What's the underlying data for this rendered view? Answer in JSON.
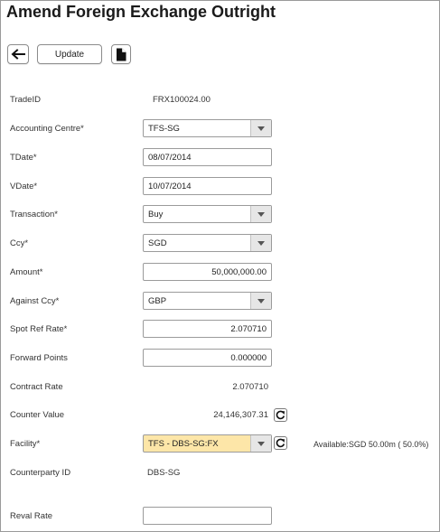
{
  "title": "Amend Foreign Exchange Outright",
  "toolbar": {
    "update_label": "Update"
  },
  "fields": {
    "trade_id": {
      "label": "TradeID",
      "value": "FRX100024.00"
    },
    "accounting_centre": {
      "label": "Accounting Centre*",
      "value": "TFS-SG"
    },
    "tdate": {
      "label": "TDate*",
      "value": "08/07/2014"
    },
    "vdate": {
      "label": "VDate*",
      "value": "10/07/2014"
    },
    "transaction": {
      "label": "Transaction*",
      "value": "Buy"
    },
    "ccy": {
      "label": "Ccy*",
      "value": "SGD"
    },
    "amount": {
      "label": "Amount*",
      "value": "50,000,000.00"
    },
    "against_ccy": {
      "label": "Against Ccy*",
      "value": "GBP"
    },
    "spot_ref_rate": {
      "label": "Spot Ref Rate*",
      "value": "2.070710"
    },
    "forward_points": {
      "label": "Forward Points",
      "value": "0.000000"
    },
    "contract_rate": {
      "label": "Contract Rate",
      "value": "2.070710"
    },
    "counter_value": {
      "label": "Counter Value",
      "value": "24,146,307.31"
    },
    "facility": {
      "label": "Facility*",
      "value": "TFS - DBS-SG:FX",
      "available": "Available:SGD 50.00m ( 50.0%)"
    },
    "counterparty_id": {
      "label": "Counterparty ID",
      "value": "DBS-SG"
    },
    "reval_rate": {
      "label": "Reval Rate",
      "value": ""
    }
  },
  "icons": {
    "back": "arrow-left-icon",
    "document": "document-icon",
    "refresh": "refresh-icon",
    "dropdown": "chevron-down-icon"
  },
  "colors": {
    "facility_highlight": "#fde6a8",
    "border": "#9b9b9b"
  }
}
